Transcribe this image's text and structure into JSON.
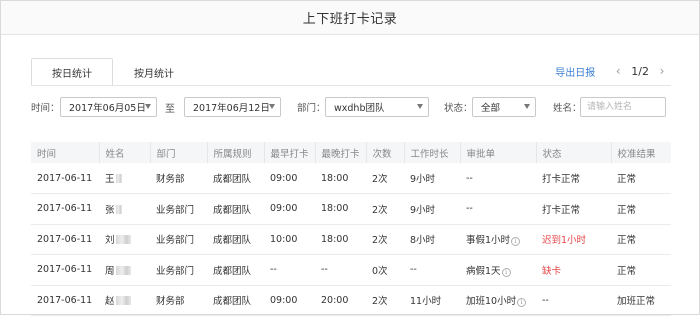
{
  "window": {
    "title": "上下班打卡记录"
  },
  "tabs": [
    {
      "label": "按日统计",
      "active": true
    },
    {
      "label": "按月统计",
      "active": false
    }
  ],
  "toolbar": {
    "export_label": "导出日报",
    "pager": {
      "current": "1/2",
      "prev_icon": "chevron-left-icon",
      "next_icon": "chevron-right-icon"
    }
  },
  "filters": {
    "time_label": "时间：",
    "date_start": "2017年06月05日",
    "range_sep": "至",
    "date_end": "2017年06月12日",
    "dept_label": "部门：",
    "dept_value": "wxdhb团队",
    "status_label": "状态：",
    "status_value": "全部",
    "name_label": "姓名：",
    "name_placeholder": "请输入姓名",
    "name_value": ""
  },
  "table": {
    "columns": [
      "时间",
      "姓名",
      "部门",
      "所属规则",
      "最早打卡",
      "最晚打卡",
      "次数",
      "工作时长",
      "审批单",
      "状态",
      "校准结果"
    ],
    "rows": [
      {
        "date": "2017-06-11",
        "name": "王",
        "dept": "财务部",
        "rule": "成都团队",
        "earliest": "09:00",
        "latest": "18:00",
        "count": "2次",
        "hours": "9小时",
        "approval": "--",
        "approval_info": false,
        "status": "打卡正常",
        "status_alert": false,
        "result": "正常"
      },
      {
        "date": "2017-06-11",
        "name": "张",
        "dept": "业务部门",
        "rule": "成都团队",
        "earliest": "09:00",
        "latest": "18:00",
        "count": "2次",
        "hours": "9小时",
        "approval": "--",
        "approval_info": false,
        "status": "打卡正常",
        "status_alert": false,
        "result": "正常"
      },
      {
        "date": "2017-06-11",
        "name": "刘",
        "dept": "业务部门",
        "rule": "成都团队",
        "earliest": "10:00",
        "latest": "18:00",
        "count": "2次",
        "hours": "8小时",
        "approval": "事假1小时",
        "approval_info": true,
        "status": "迟到1小时",
        "status_alert": true,
        "result": "正常"
      },
      {
        "date": "2017-06-11",
        "name": "周",
        "dept": "业务部门",
        "rule": "成都团队",
        "earliest": "--",
        "latest": "--",
        "count": "0次",
        "hours": "--",
        "approval": "病假1天",
        "approval_info": true,
        "status": "缺卡",
        "status_alert": true,
        "result": "正常"
      },
      {
        "date": "2017-06-11",
        "name": "赵",
        "dept": "财务部",
        "rule": "成都团队",
        "earliest": "09:00",
        "latest": "20:00",
        "count": "2次",
        "hours": "11小时",
        "approval": "加班10小时",
        "approval_info": true,
        "status": "--",
        "status_alert": false,
        "result": "加班正常"
      }
    ]
  },
  "colors": {
    "accent": "#3a7fd1",
    "alert": "#e54848",
    "header_bg": "#f5f6f8"
  }
}
